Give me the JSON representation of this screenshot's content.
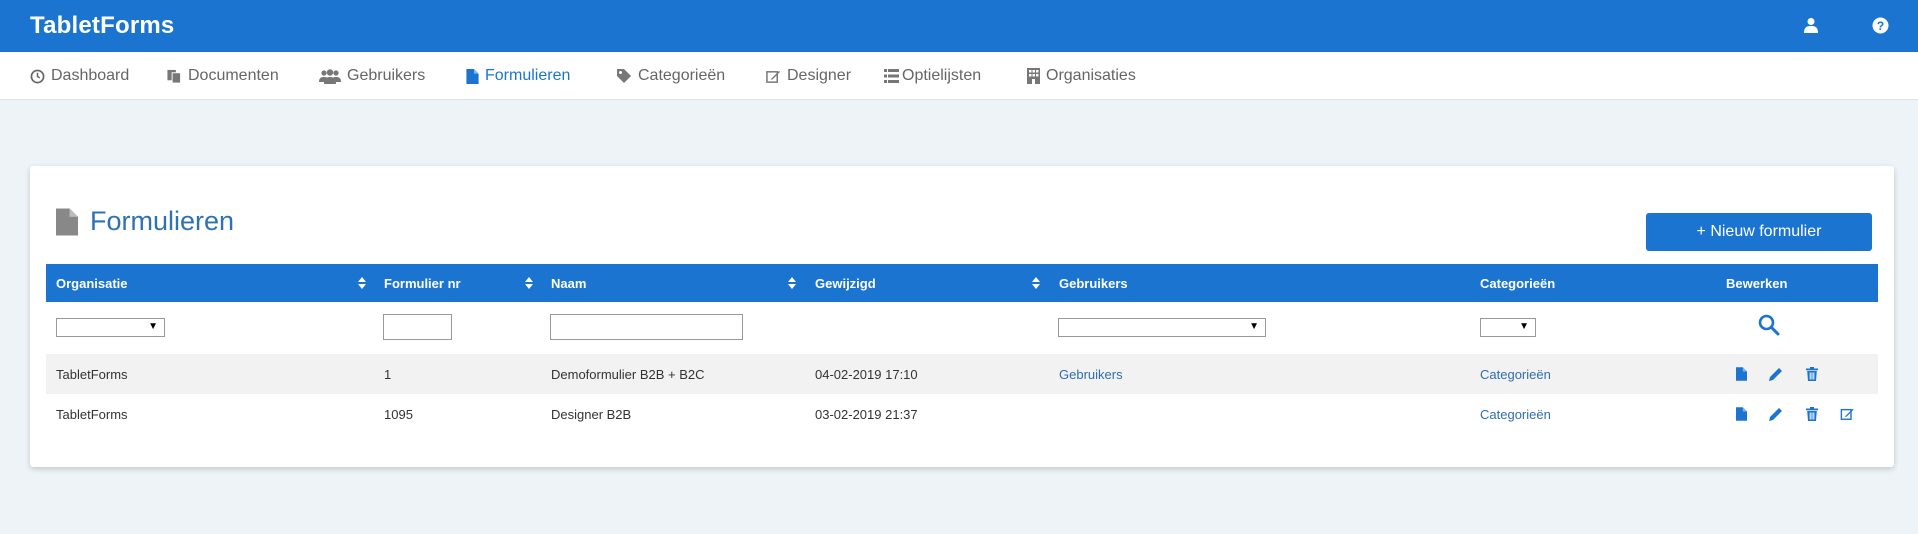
{
  "app": {
    "title": "TabletForms"
  },
  "header_icons": {
    "user": "user-icon",
    "help": "help-icon"
  },
  "nav": [
    {
      "label": "Dashboard",
      "icon": "clock-icon"
    },
    {
      "label": "Documenten",
      "icon": "documents-icon"
    },
    {
      "label": "Gebruikers",
      "icon": "users-icon"
    },
    {
      "label": "Formulieren",
      "icon": "file-icon",
      "active": true
    },
    {
      "label": "Categorieën",
      "icon": "tag-icon"
    },
    {
      "label": "Designer",
      "icon": "edit-icon"
    },
    {
      "label": "Optielijsten",
      "icon": "list-icon"
    },
    {
      "label": "Organisaties",
      "icon": "building-icon"
    }
  ],
  "page": {
    "title": "Formulieren",
    "new_button": "+ Nieuw formulier"
  },
  "table": {
    "columns": [
      "Organisatie",
      "Formulier nr",
      "Naam",
      "Gewijzigd",
      "Gebruikers",
      "Categorieën",
      "Bewerken"
    ],
    "rows": [
      {
        "organisatie": "TabletForms",
        "nr": "1",
        "naam": "Demoformulier B2B + B2C",
        "gewijzigd": "04-02-2019 17:10",
        "gebruikers": "Gebruikers",
        "categorieen": "Categorieën"
      },
      {
        "organisatie": "TabletForms",
        "nr": "1095",
        "naam": "Designer B2B",
        "gewijzigd": "03-02-2019 21:37",
        "gebruikers": "",
        "categorieen": "Categorieën"
      }
    ]
  },
  "colors": {
    "primary": "#1b75d0",
    "link": "#2f6eb0",
    "background": "#edf3f6"
  }
}
